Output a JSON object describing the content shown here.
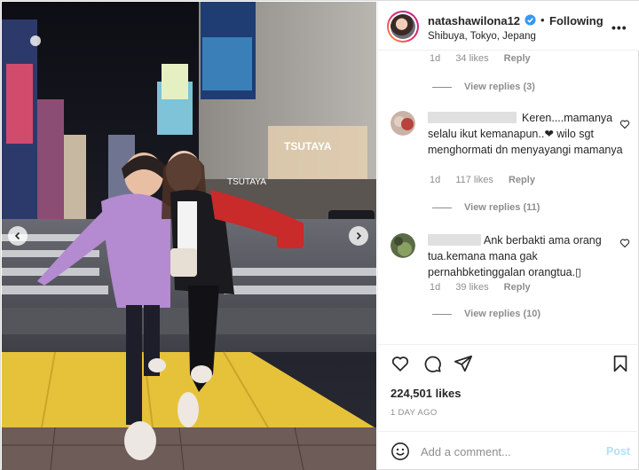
{
  "post": {
    "username": "natashawilona12",
    "separator": "•",
    "follow_status": "Following",
    "location": "Shibuya, Tokyo, Jepang",
    "more_icon": "more-options-icon",
    "photo_sign": "TSUTAYA"
  },
  "comments": {
    "top_meta": {
      "time": "1d",
      "likes": "34 likes",
      "reply": "Reply"
    },
    "top_view_replies": "View replies (3)",
    "items": [
      {
        "text": "Keren....mamanya selalu ikut kemanapun..❤ wilo sgt menghormati dn menyayangi mamanya",
        "time": "1d",
        "likes": "117 likes",
        "reply": "Reply",
        "view_replies": "View replies (11)"
      },
      {
        "text": "Ank berbakti ama orang tua.kemana mana gak pernahbketinggalan orangtua.▯",
        "time": "1d",
        "likes": "39 likes",
        "reply": "Reply",
        "view_replies": "View replies (10)"
      }
    ]
  },
  "actions": {
    "likes_count": "224,501 likes",
    "date": "1 DAY AGO"
  },
  "add_comment": {
    "placeholder": "Add a comment...",
    "post_label": "Post"
  },
  "colors": {
    "verified": "#3897f0",
    "muted": "#8e8e8e",
    "post_disabled": "#b2dffc"
  }
}
